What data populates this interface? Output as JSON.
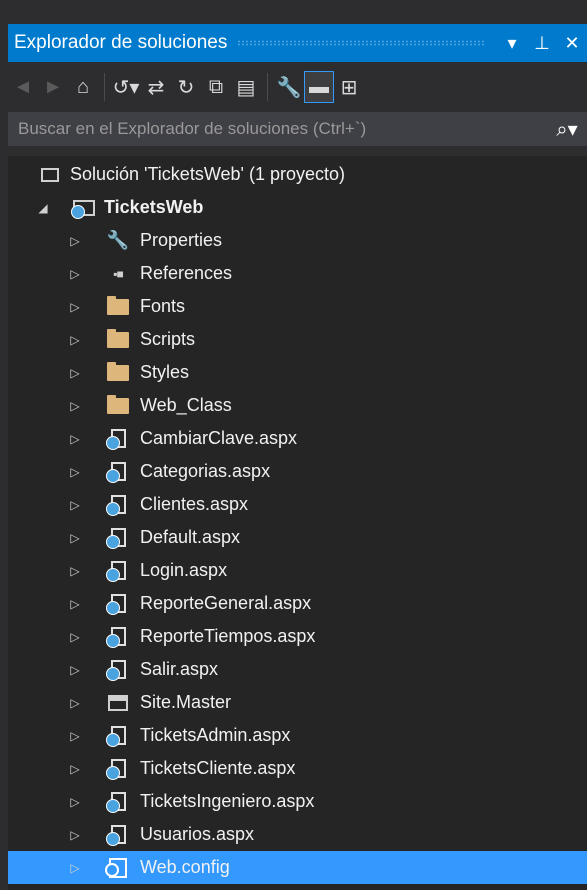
{
  "panel": {
    "title": "Explorador de soluciones",
    "controls": {
      "dropdown": "▼",
      "pin": "📌",
      "close": "✕"
    }
  },
  "toolbar": {
    "items": [
      {
        "name": "back-icon",
        "glyph": "◀",
        "enabled": false
      },
      {
        "name": "forward-icon",
        "glyph": "▶",
        "enabled": false
      },
      {
        "name": "home-icon",
        "glyph": "⌂",
        "enabled": true
      },
      {
        "name": "history-icon",
        "glyph": "⟲",
        "enabled": true
      },
      {
        "name": "sync-icon",
        "glyph": "⇄",
        "enabled": true
      },
      {
        "name": "refresh-icon",
        "glyph": "↻",
        "enabled": true
      },
      {
        "name": "collapse-all-icon",
        "glyph": "⧉",
        "enabled": true
      },
      {
        "name": "show-all-files-icon",
        "glyph": "▤",
        "enabled": true
      },
      {
        "name": "properties-icon",
        "glyph": "🔧",
        "enabled": true
      },
      {
        "name": "preview-icon",
        "glyph": "▬",
        "enabled": true
      },
      {
        "name": "view-class-diagram-icon",
        "glyph": "⊞",
        "enabled": true
      }
    ]
  },
  "search": {
    "placeholder": "Buscar en el Explorador de soluciones (Ctrl+`)",
    "icon": "search-icon"
  },
  "tree": {
    "solution_label": "Solución 'TicketsWeb'  (1 proyecto)",
    "project_label": "TicketsWeb",
    "items": [
      {
        "label": "Properties",
        "icon": "wrench-icon"
      },
      {
        "label": "References",
        "icon": "references-icon"
      },
      {
        "label": "Fonts",
        "icon": "folder-icon"
      },
      {
        "label": "Scripts",
        "icon": "folder-icon"
      },
      {
        "label": "Styles",
        "icon": "folder-icon"
      },
      {
        "label": "Web_Class",
        "icon": "folder-icon"
      },
      {
        "label": "CambiarClave.aspx",
        "icon": "aspx-page-icon"
      },
      {
        "label": "Categorias.aspx",
        "icon": "aspx-page-icon"
      },
      {
        "label": "Clientes.aspx",
        "icon": "aspx-page-icon"
      },
      {
        "label": "Default.aspx",
        "icon": "aspx-page-icon"
      },
      {
        "label": "Login.aspx",
        "icon": "aspx-page-icon"
      },
      {
        "label": "ReporteGeneral.aspx",
        "icon": "aspx-page-icon"
      },
      {
        "label": "ReporteTiempos.aspx",
        "icon": "aspx-page-icon"
      },
      {
        "label": "Salir.aspx",
        "icon": "aspx-page-icon"
      },
      {
        "label": "Site.Master",
        "icon": "master-page-icon"
      },
      {
        "label": "TicketsAdmin.aspx",
        "icon": "aspx-page-icon"
      },
      {
        "label": "TicketsCliente.aspx",
        "icon": "aspx-page-icon"
      },
      {
        "label": "TicketsIngeniero.aspx",
        "icon": "aspx-page-icon"
      },
      {
        "label": "Usuarios.aspx",
        "icon": "aspx-page-icon"
      },
      {
        "label": "Web.config",
        "icon": "config-file-icon",
        "selected": true
      }
    ]
  },
  "colors": {
    "accent": "#007acc",
    "selection": "#3399ff",
    "background": "#252526",
    "folder": "#dcb67a"
  }
}
